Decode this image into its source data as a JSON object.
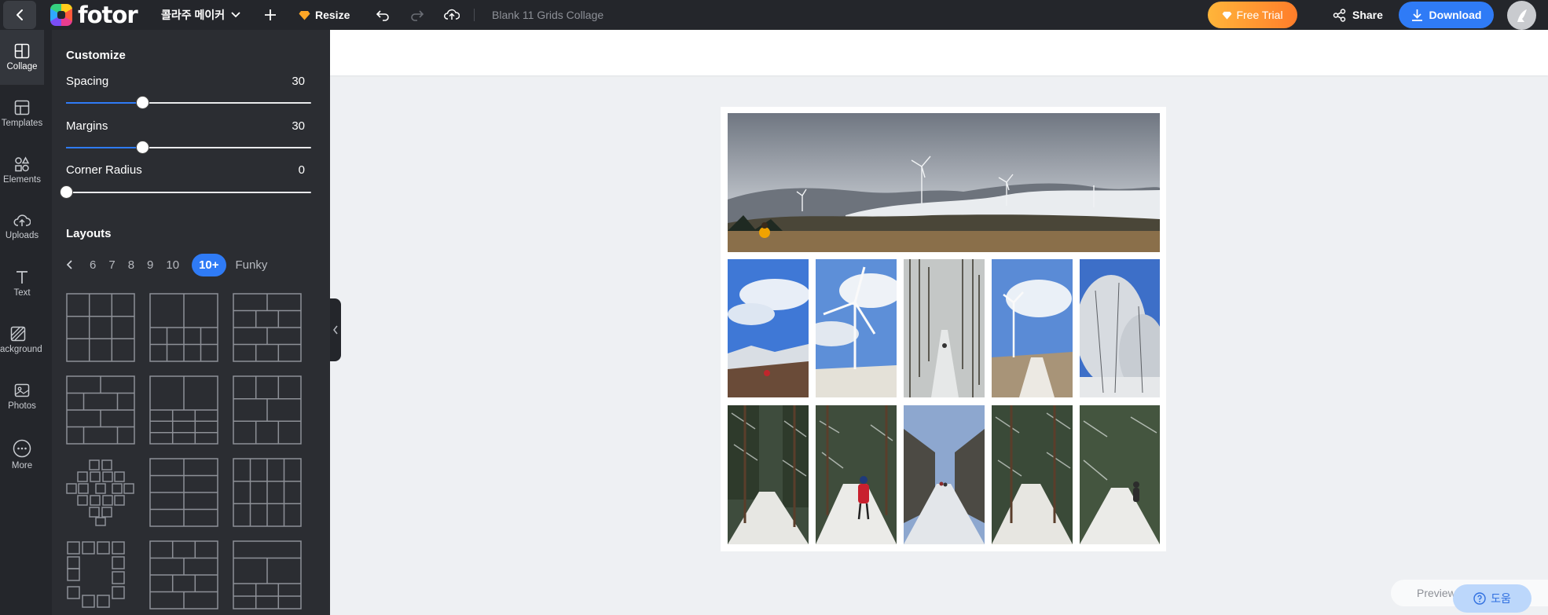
{
  "topbar": {
    "logo_text": "fotor",
    "mode_label": "콜라주 메이커",
    "resize_label": "Resize",
    "doc_title": "Blank 11 Grids Collage",
    "free_trial_label": "Free Trial",
    "share_label": "Share",
    "download_label": "Download",
    "colors": {
      "bar": "#24262b",
      "download": "#2f7bf6",
      "trial_start": "#ffb53a",
      "trial_end": "#ff7d2a"
    }
  },
  "rail": {
    "items": [
      {
        "label": "Collage",
        "icon": "collage-icon",
        "active": true
      },
      {
        "label": "Templates",
        "icon": "templates-icon"
      },
      {
        "label": "Elements",
        "icon": "elements-icon"
      },
      {
        "label": "Uploads",
        "icon": "upload-cloud-icon"
      },
      {
        "label": "Text",
        "icon": "text-icon"
      },
      {
        "label": "Background",
        "icon": "background-icon"
      },
      {
        "label": "Photos",
        "icon": "photos-icon"
      },
      {
        "label": "More",
        "icon": "more-icon"
      }
    ]
  },
  "panel": {
    "customize_title": "Customize",
    "spacing": {
      "label": "Spacing",
      "value": "30",
      "fraction": 0.31
    },
    "margins": {
      "label": "Margins",
      "value": "30",
      "fraction": 0.31
    },
    "corner_radius": {
      "label": "Corner Radius",
      "value": "0",
      "fraction": 0.0
    },
    "layouts_title": "Layouts",
    "layout_tabs": [
      "6",
      "7",
      "8",
      "9",
      "10",
      "10+",
      "Funky"
    ],
    "active_tab": "10+"
  },
  "canvas": {
    "preview_label": "Preview",
    "help_label": "도움"
  }
}
